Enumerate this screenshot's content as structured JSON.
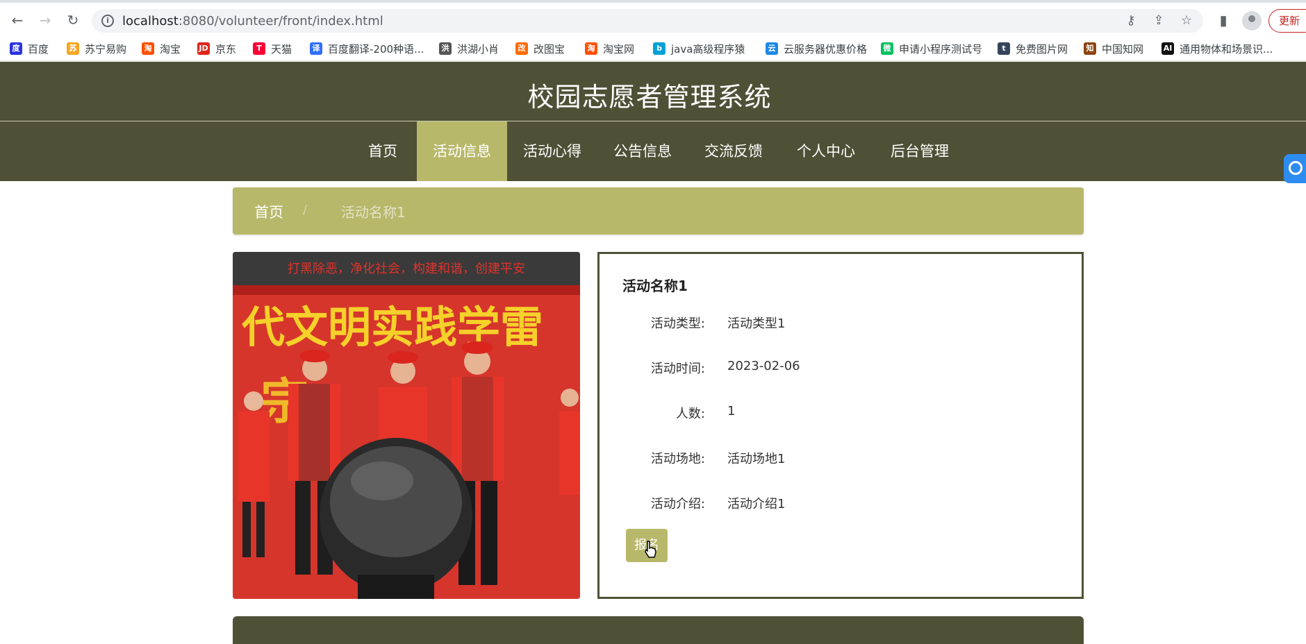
{
  "browser": {
    "url_host": "localhost",
    "url_path": ":8080/volunteer/front/index.html",
    "update_label": "更新",
    "bookmarks": [
      {
        "label": "百度",
        "icon": "baidu-icon",
        "color": "#2932e1",
        "glyph": "度"
      },
      {
        "label": "苏宁易购",
        "icon": "suning-icon",
        "color": "#f5a623",
        "glyph": "苏"
      },
      {
        "label": "淘宝",
        "icon": "taobao-icon",
        "color": "#ff5000",
        "glyph": "淘"
      },
      {
        "label": "京东",
        "icon": "jd-icon",
        "color": "#e1251b",
        "glyph": "JD"
      },
      {
        "label": "天猫",
        "icon": "tmall-icon",
        "color": "#ff0036",
        "glyph": "T"
      },
      {
        "label": "百度翻译-200种语...",
        "icon": "baidu-translate-icon",
        "color": "#2f6fff",
        "glyph": "译"
      },
      {
        "label": "洪湖小肖",
        "icon": "hongHu-icon",
        "color": "#555555",
        "glyph": "洪"
      },
      {
        "label": "改图宝",
        "icon": "gaitubao-icon",
        "color": "#ff6a00",
        "glyph": "改"
      },
      {
        "label": "淘宝网",
        "icon": "taobao-net-icon",
        "color": "#ff5000",
        "glyph": "淘"
      },
      {
        "label": "java高级程序猿",
        "icon": "bilibili-icon",
        "color": "#00a1d6",
        "glyph": "b"
      },
      {
        "label": "云服务器优惠价格",
        "icon": "cloud-icon",
        "color": "#1e88e5",
        "glyph": "云"
      },
      {
        "label": "申请小程序测试号",
        "icon": "wechat-icon",
        "color": "#07c160",
        "glyph": "微"
      },
      {
        "label": "免费图片网",
        "icon": "tumblr-icon",
        "color": "#35465c",
        "glyph": "t"
      },
      {
        "label": "中国知网",
        "icon": "cnki-icon",
        "color": "#8b4513",
        "glyph": "知"
      },
      {
        "label": "通用物体和场景识...",
        "icon": "ai-icon",
        "color": "#111111",
        "glyph": "AI"
      }
    ]
  },
  "site": {
    "title": "校园志愿者管理系统",
    "nav": [
      {
        "label": "首页",
        "active": false
      },
      {
        "label": "活动信息",
        "active": true
      },
      {
        "label": "活动心得",
        "active": false
      },
      {
        "label": "公告信息",
        "active": false
      },
      {
        "label": "交流反馈",
        "active": false
      },
      {
        "label": "个人中心",
        "active": false
      },
      {
        "label": "后台管理",
        "active": false
      }
    ],
    "colors": {
      "primary": "#4f5137",
      "accent": "#b8b86b"
    }
  },
  "breadcrumb": {
    "home": "首页",
    "separator": "/",
    "current": "活动名称1"
  },
  "activity": {
    "name": "活动名称1",
    "fields": [
      {
        "label": "活动类型:",
        "value": "活动类型1"
      },
      {
        "label": "活动时间:",
        "value": "2023-02-06"
      },
      {
        "label": "人数:",
        "value": "1"
      },
      {
        "label": "活动场地:",
        "value": "活动场地1"
      },
      {
        "label": "活动介绍:",
        "value": "活动介绍1"
      }
    ],
    "signup_label": "报名",
    "photo_banner_top": "打黑除恶，净化社会，构建和谐，创建平安",
    "photo_banner_main": "代文明实践学雷"
  }
}
